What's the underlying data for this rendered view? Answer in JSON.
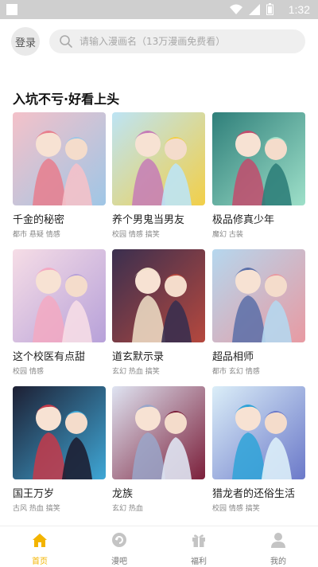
{
  "status": {
    "time": "1:32"
  },
  "header": {
    "login_label": "登录",
    "search_placeholder": "请输入漫画名（13万漫画免费看）"
  },
  "section": {
    "title": "入坑不亏·好看上头"
  },
  "comics": [
    {
      "title": "千金的秘密",
      "tags": "都市 悬疑 情感",
      "palette": [
        "#f4c1c9",
        "#9fc6e6",
        "#e87e8d"
      ]
    },
    {
      "title": "养个男鬼当男友",
      "tags": "校园 情感 搞笑",
      "palette": [
        "#bde4f5",
        "#f2cf48",
        "#c57bb7"
      ]
    },
    {
      "title": "极品修真少年",
      "tags": "魔幻 古装",
      "palette": [
        "#2f7f7a",
        "#9ee0c9",
        "#c24b6c"
      ]
    },
    {
      "title": "这个校医有点甜",
      "tags": "校园 情感",
      "palette": [
        "#f6dde6",
        "#b7a1d9",
        "#f3a9c2"
      ]
    },
    {
      "title": "道玄默示录",
      "tags": "玄幻 热血 搞笑",
      "palette": [
        "#3a2f4f",
        "#b5483e",
        "#f0e0c8"
      ]
    },
    {
      "title": "超品相师",
      "tags": "都市 玄幻 情感",
      "palette": [
        "#b5d7ee",
        "#e89aa2",
        "#5a6fa8"
      ]
    },
    {
      "title": "国王万岁",
      "tags": "古风 热血 搞笑",
      "palette": [
        "#1d1f33",
        "#3fa7d6",
        "#c43a4a"
      ]
    },
    {
      "title": "龙族",
      "tags": "玄幻 热血",
      "palette": [
        "#dfe4f2",
        "#7b1f3a",
        "#9aa6c9"
      ]
    },
    {
      "title": "猎龙者的还俗生活",
      "tags": "校园 情感 搞笑",
      "palette": [
        "#dbeef8",
        "#6b79c9",
        "#2fa3d8"
      ]
    }
  ],
  "tabs": [
    {
      "label": "首页",
      "icon": "home-icon",
      "active": true
    },
    {
      "label": "漫吧",
      "icon": "refresh-icon",
      "active": false
    },
    {
      "label": "福利",
      "icon": "gift-icon",
      "active": false
    },
    {
      "label": "我的",
      "icon": "user-icon",
      "active": false
    }
  ],
  "colors": {
    "accent": "#f3b400"
  }
}
